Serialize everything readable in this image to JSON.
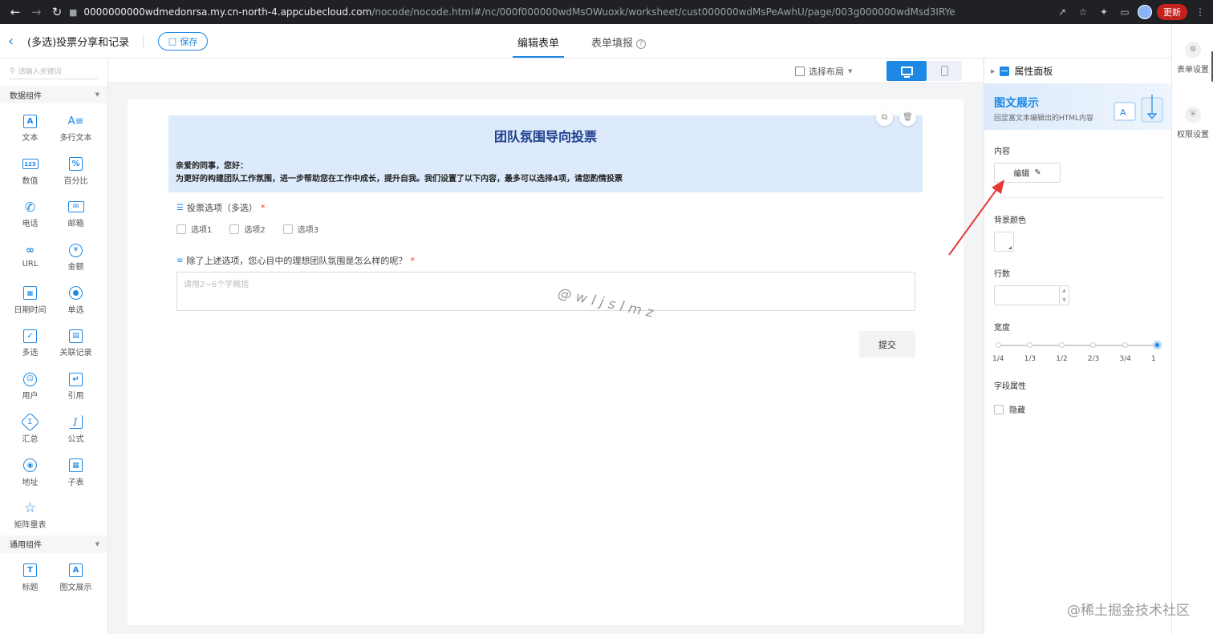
{
  "browser": {
    "url_host": "0000000000wdmedonrsa.my.cn-north-4.appcubecloud.com",
    "url_path": "/nocode/nocode.html#/nc/000f000000wdMsOWuoxk/worksheet/cust000000wdMsPeAwhU/page/003g000000wdMsd3IRYe",
    "update_label": "更新"
  },
  "header": {
    "title": "(多选)投票分享和记录",
    "save_label": "保存",
    "tabs": [
      {
        "label": "编辑表单",
        "active": true
      },
      {
        "label": "表单填报",
        "active": false
      }
    ]
  },
  "sidebar": {
    "search_placeholder": "请输入关键词",
    "section1": "数据组件",
    "components": [
      {
        "label": "文本",
        "icon": "text-icon"
      },
      {
        "label": "多行文本",
        "icon": "multiline-text-icon"
      },
      {
        "label": "数值",
        "icon": "number-icon"
      },
      {
        "label": "百分比",
        "icon": "percent-icon"
      },
      {
        "label": "电话",
        "icon": "phone-icon"
      },
      {
        "label": "邮箱",
        "icon": "email-icon"
      },
      {
        "label": "URL",
        "icon": "link-icon"
      },
      {
        "label": "金额",
        "icon": "yen-icon"
      },
      {
        "label": "日期时间",
        "icon": "calendar-icon"
      },
      {
        "label": "单选",
        "icon": "radio-icon"
      },
      {
        "label": "多选",
        "icon": "checkbox-icon"
      },
      {
        "label": "关联记录",
        "icon": "relation-icon"
      },
      {
        "label": "用户",
        "icon": "user-icon"
      },
      {
        "label": "引用",
        "icon": "reference-icon"
      },
      {
        "label": "汇总",
        "icon": "summary-icon"
      },
      {
        "label": "公式",
        "icon": "formula-icon"
      },
      {
        "label": "地址",
        "icon": "location-icon"
      },
      {
        "label": "子表",
        "icon": "subtable-icon"
      },
      {
        "label": "矩阵量表",
        "icon": "matrix-icon"
      }
    ],
    "section2": "通用组件",
    "general": [
      {
        "label": "标题",
        "icon": "heading-icon"
      },
      {
        "label": "图文展示",
        "icon": "rich-text-icon"
      }
    ]
  },
  "toolbar": {
    "layout_label": "选择布局"
  },
  "form": {
    "banner_title": "团队氛围导向投票",
    "greeting": "亲爱的同事，您好：",
    "intro": "为更好的构建团队工作氛围，进一步帮助您在工作中成长，提升自我。我们设置了以下内容，最多可以选择4项，请您酌情投票",
    "q1_label": "投票选项（多选）",
    "q1_options": [
      "选项1",
      "选项2",
      "选项3"
    ],
    "q2_label": "除了上述选项，您心目中的理想团队氛围是怎么样的呢？",
    "q2_placeholder": "请用2~6个字概括",
    "submit_label": "提交",
    "required_mark": "*"
  },
  "watermark": "@wljslmz",
  "panel": {
    "title": "属性面板",
    "component_name": "图文展示",
    "component_desc": "回显富文本编辑出的HTML内容",
    "content_label": "内容",
    "edit_label": "编辑",
    "bg_color_label": "背景颜色",
    "rows_label": "行数",
    "width_label": "宽度",
    "width_options": [
      "1/4",
      "1/3",
      "1/2",
      "2/3",
      "3/4",
      "1"
    ],
    "width_selected": "1",
    "field_attr_label": "字段属性",
    "hide_label": "隐藏"
  },
  "rail": {
    "form_settings": "表单设置",
    "permission_settings": "权限设置"
  },
  "site_mark": "@稀土掘金技术社区",
  "colors": {
    "accent": "#1e88e5",
    "banner_bg": "#dceafb",
    "banner_title": "#1d3e8c",
    "annotation_arrow": "#e53935"
  }
}
